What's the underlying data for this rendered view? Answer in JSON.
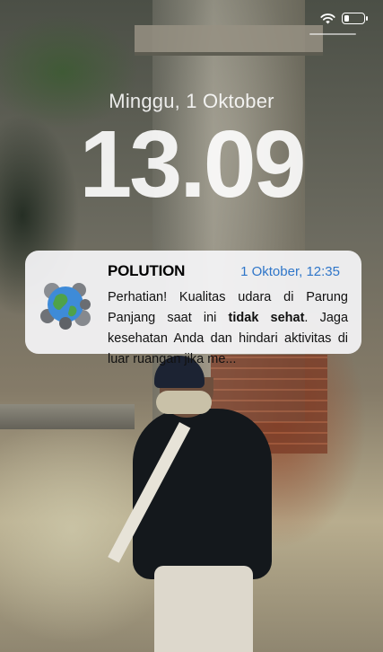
{
  "lockscreen": {
    "date": "Minggu, 1 Oktober",
    "time": "13.09"
  },
  "status_bar": {
    "wifi_icon": "wifi-icon",
    "battery_icon": "battery-icon",
    "battery_level": 0.25
  },
  "notification": {
    "app_name": "POLUTION",
    "timestamp": "1 Oktober, 12:35",
    "app_icon": "earth-pollution-icon",
    "message_before": "Perhatian! Kualitas udara di Parung Panjang saat ini ",
    "message_bold": "tidak sehat",
    "message_after": ". Jaga kesehatan Anda dan hindari aktivitas  di luar ruangan jika me...",
    "timestamp_color": "#2f76c9"
  }
}
